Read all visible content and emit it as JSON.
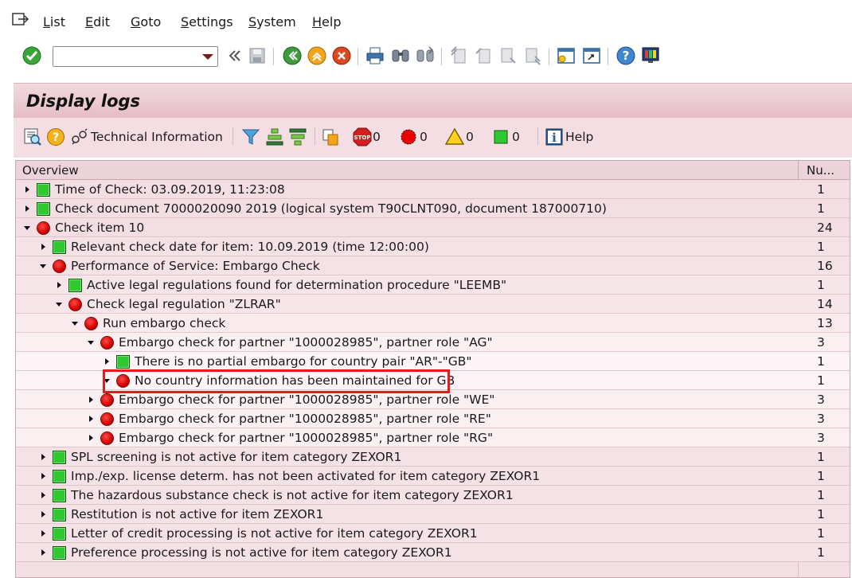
{
  "menu": {
    "items": [
      "List",
      "Edit",
      "Goto",
      "Settings",
      "System",
      "Help"
    ]
  },
  "system_toolbar": {
    "command_field_value": ""
  },
  "title": "Display logs",
  "app_toolbar": {
    "technical_information_label": "Technical Information",
    "stop_count": "0",
    "error_count": "0",
    "warning_count": "0",
    "success_count": "0",
    "help_label": "Help"
  },
  "tree": {
    "header_overview": "Overview",
    "header_number": "Nu...",
    "rows": [
      {
        "text": "Time of Check: 03.09.2019, 11:23:08",
        "num": "1",
        "level": 0,
        "status": "green",
        "expanded": false
      },
      {
        "text": "Check document 7000020090 2019 (logical system T90CLNT090, document 187000710)",
        "num": "1",
        "level": 0,
        "status": "green",
        "expanded": false
      },
      {
        "text": "Check item 10",
        "num": "24",
        "level": 0,
        "status": "red",
        "expanded": true
      },
      {
        "text": "Relevant check date for item: 10.09.2019 (time 12:00:00)",
        "num": "1",
        "level": 1,
        "status": "green",
        "expanded": false
      },
      {
        "text": "Performance of Service: Embargo Check",
        "num": "16",
        "level": 1,
        "status": "red",
        "expanded": true
      },
      {
        "text": "Active legal regulations found for determination procedure \"LEEMB\"",
        "num": "1",
        "level": 2,
        "status": "green",
        "expanded": false
      },
      {
        "text": "Check legal regulation \"ZLRAR\"",
        "num": "14",
        "level": 2,
        "status": "red",
        "expanded": true
      },
      {
        "text": "Run embargo check",
        "num": "13",
        "level": 3,
        "status": "red",
        "expanded": true
      },
      {
        "text": "Embargo check for partner \"1000028985\", partner role \"AG\"",
        "num": "3",
        "level": 4,
        "status": "red",
        "expanded": true
      },
      {
        "text": "There is no partial embargo for country pair \"AR\"-\"GB\"",
        "num": "1",
        "level": 5,
        "status": "green",
        "expanded": false
      },
      {
        "text": "No country information has been maintained for GB",
        "num": "1",
        "level": 5,
        "status": "red",
        "expanded": true
      },
      {
        "text": "Embargo check for partner \"1000028985\", partner role \"WE\"",
        "num": "3",
        "level": 4,
        "status": "red",
        "expanded": false
      },
      {
        "text": "Embargo check for partner \"1000028985\", partner role \"RE\"",
        "num": "3",
        "level": 4,
        "status": "red",
        "expanded": false
      },
      {
        "text": "Embargo check for partner \"1000028985\", partner role \"RG\"",
        "num": "3",
        "level": 4,
        "status": "red",
        "expanded": false
      },
      {
        "text": "SPL screening is not active for item category ZEXOR1",
        "num": "1",
        "level": 1,
        "status": "green",
        "expanded": false
      },
      {
        "text": "Imp./exp. license determ. has not been activated for item category ZEXOR1",
        "num": "1",
        "level": 1,
        "status": "green",
        "expanded": false
      },
      {
        "text": "The hazardous substance check is not active for item category ZEXOR1",
        "num": "1",
        "level": 1,
        "status": "green",
        "expanded": false
      },
      {
        "text": "Restitution is not active for item ZEXOR1",
        "num": "1",
        "level": 1,
        "status": "green",
        "expanded": false
      },
      {
        "text": "Letter of credit processing is not active for item category ZEXOR1",
        "num": "1",
        "level": 1,
        "status": "green",
        "expanded": false
      },
      {
        "text": "Preference processing is not active for item category ZEXOR1",
        "num": "1",
        "level": 1,
        "status": "green",
        "expanded": false
      }
    ]
  },
  "colors": {
    "title_bar": "#e6bcc6",
    "tree_background": "#f3dfe3",
    "status_green": "#2fc82f",
    "status_red": "#d40000",
    "highlight_border": "#e31b1b"
  }
}
